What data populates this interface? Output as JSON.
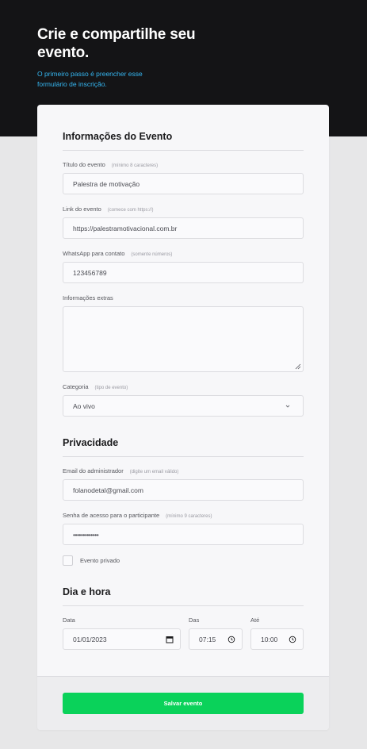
{
  "hero": {
    "title": "Crie e compartilhe seu evento.",
    "subtitle": "O primeiro passo é preencher esse formulário de inscrição."
  },
  "sections": {
    "event_info": "Informações do Evento",
    "privacy": "Privacidade",
    "datetime": "Dia e hora"
  },
  "fields": {
    "title": {
      "label": "Título do evento",
      "hint": "(mínimo 8 caracteres)",
      "value": "Palestra de motivação"
    },
    "link": {
      "label": "Link do evento",
      "hint": "(comece com https://)",
      "value": "https://palestramotivacional.com.br"
    },
    "whatsapp": {
      "label": "WhatsApp para contato",
      "hint": "(somente números)",
      "value": "123456789"
    },
    "extras": {
      "label": "Informações extras",
      "value": ""
    },
    "category": {
      "label": "Categoria",
      "hint": "(tipo de evento)",
      "value": "Ao vivo"
    },
    "admin_email": {
      "label": "Email do administrador",
      "hint": "(digite um email válido)",
      "value": "folanodetal@gmail.com"
    },
    "password": {
      "label": "Senha de acesso para o participante",
      "hint": "(mínimo 9 caracteres)",
      "value": "•••••••••••••"
    },
    "private_event": {
      "label": "Evento privado",
      "checked": false
    },
    "date": {
      "label": "Data",
      "value": "01/01/2023"
    },
    "from": {
      "label": "Das",
      "value": "07:15"
    },
    "to": {
      "label": "Até",
      "value": "10:00"
    }
  },
  "actions": {
    "save_label": "Salvar evento"
  },
  "colors": {
    "accent": "#0ad25a",
    "hero_bg": "#141416",
    "link_blue": "#35b7f2"
  },
  "icons": {
    "select": "chevron-down-icon",
    "date": "calendar-icon",
    "time": "clock-icon",
    "resize": "resize-handle-icon"
  }
}
